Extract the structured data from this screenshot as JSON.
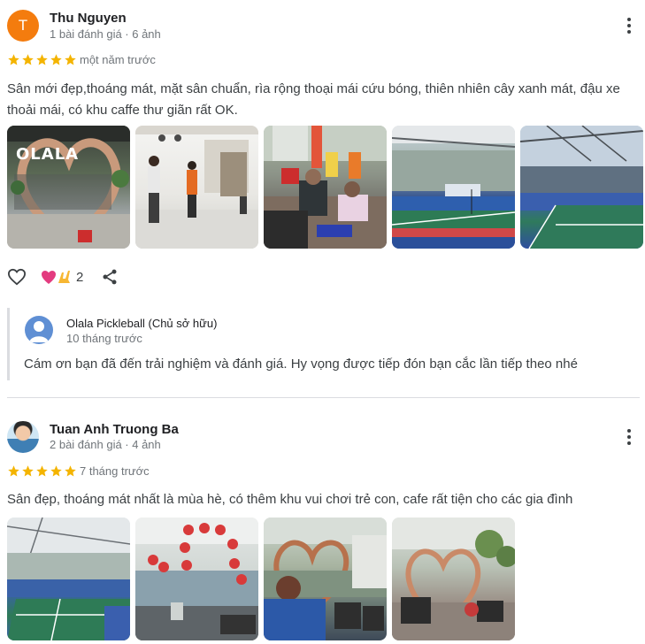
{
  "reviews": [
    {
      "author": "Thu Nguyen",
      "avatar_letter": "T",
      "meta": "1 bài đánh giá · 6 ảnh",
      "rating": 5,
      "date": "một năm trước",
      "text": "Sân mới đẹp,thoáng mát, mặt sân chuẩn, rìa rộng thoại mái cứu bóng, thiên nhiên cây xanh mát, đậu xe thoải mái, có khu caffe thư giãn rất OK.",
      "photo_sign_text": "OLALA",
      "reaction_count": "2",
      "owner_reply": {
        "name": "Olala Pickleball (Chủ sở hữu)",
        "date": "10 tháng trước",
        "text": "Cám ơn bạn đã đến trải nghiệm và đánh giá. Hy vọng được tiếp đón bạn cắc lần tiếp theo nhé"
      }
    },
    {
      "author": "Tuan Anh Truong Ba",
      "meta": "2 bài đánh giá · 4 ảnh",
      "rating": 5,
      "date": "7 tháng trước",
      "text": "Sân đẹp, thoáng mát nhất là mùa hè, có thêm khu vui chơi trẻ con, cafe rất tiện cho các gia đình"
    }
  ],
  "icons": {
    "star": "star-icon",
    "more": "more-vert-icon",
    "like": "heart-outline-icon",
    "reactions": "heart-and-hands-icon",
    "share": "share-icon"
  },
  "colors": {
    "star": "#f4b400",
    "avatar_orange": "#f47c0e",
    "text_secondary": "#70757a"
  }
}
